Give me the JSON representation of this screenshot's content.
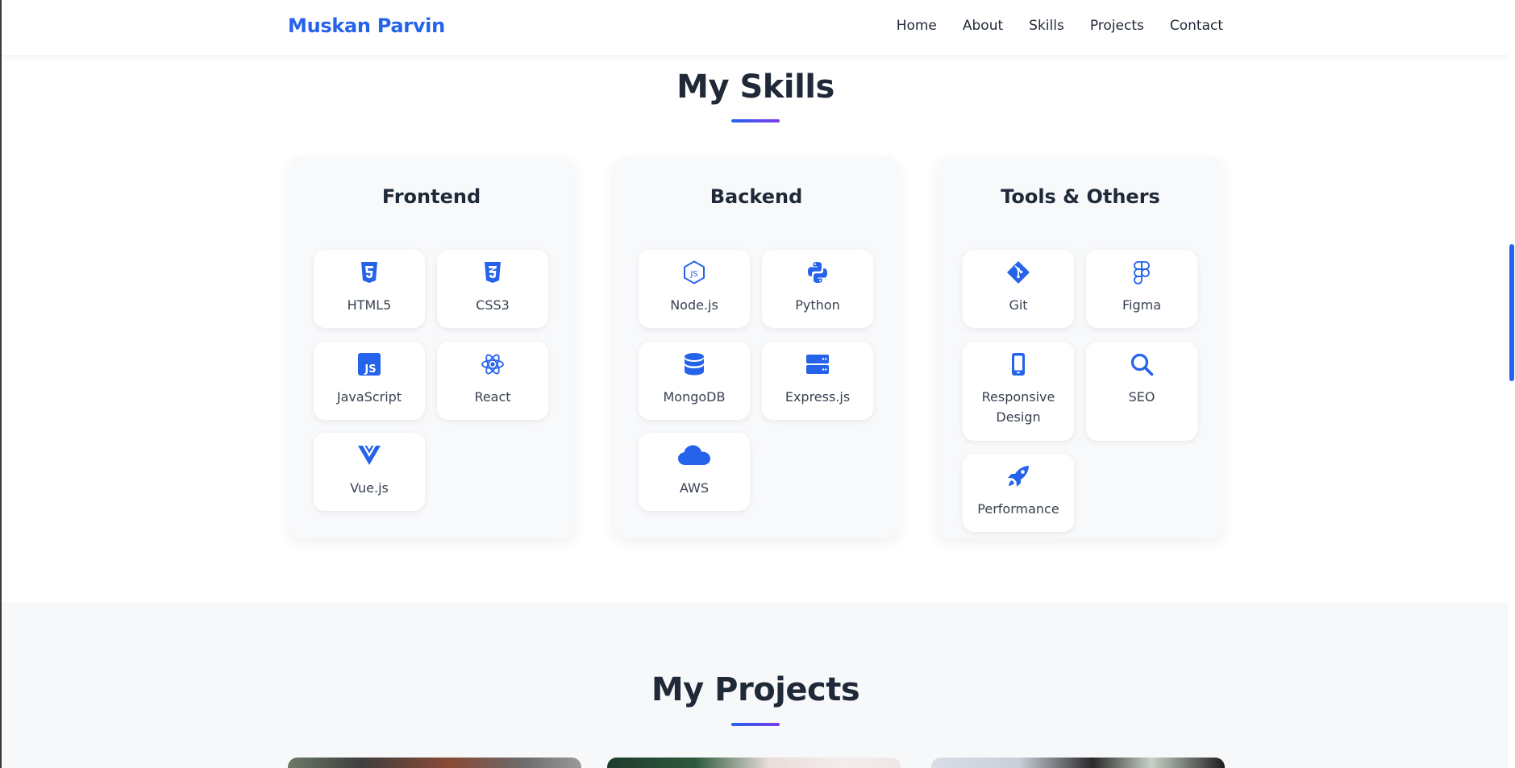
{
  "header": {
    "brand": "Muskan Parvin",
    "nav": [
      {
        "label": "Home"
      },
      {
        "label": "About"
      },
      {
        "label": "Skills"
      },
      {
        "label": "Projects"
      },
      {
        "label": "Contact"
      }
    ]
  },
  "skills": {
    "title": "My Skills",
    "categories": [
      {
        "title": "Frontend",
        "items": [
          {
            "label": "HTML5",
            "icon": "html5-icon"
          },
          {
            "label": "CSS3",
            "icon": "css3-icon"
          },
          {
            "label": "JavaScript",
            "icon": "javascript-icon"
          },
          {
            "label": "React",
            "icon": "react-icon"
          },
          {
            "label": "Vue.js",
            "icon": "vuejs-icon"
          }
        ]
      },
      {
        "title": "Backend",
        "items": [
          {
            "label": "Node.js",
            "icon": "nodejs-icon"
          },
          {
            "label": "Python",
            "icon": "python-icon"
          },
          {
            "label": "MongoDB",
            "icon": "database-icon"
          },
          {
            "label": "Express.js",
            "icon": "server-icon"
          },
          {
            "label": "AWS",
            "icon": "cloud-icon"
          }
        ]
      },
      {
        "title": "Tools & Others",
        "items": [
          {
            "label": "Git",
            "icon": "git-icon"
          },
          {
            "label": "Figma",
            "icon": "figma-icon"
          },
          {
            "label": "Responsive Design",
            "icon": "mobile-icon"
          },
          {
            "label": "SEO",
            "icon": "search-icon"
          },
          {
            "label": "Performance",
            "icon": "rocket-icon"
          }
        ]
      }
    ]
  },
  "projects": {
    "title": "My Projects"
  },
  "colors": {
    "accent": "#2563eb",
    "accent_secondary": "#7c3aed",
    "text": "#1f2937",
    "card_bg": "#f8f9fb",
    "section_alt_bg": "#f7f8fa"
  }
}
